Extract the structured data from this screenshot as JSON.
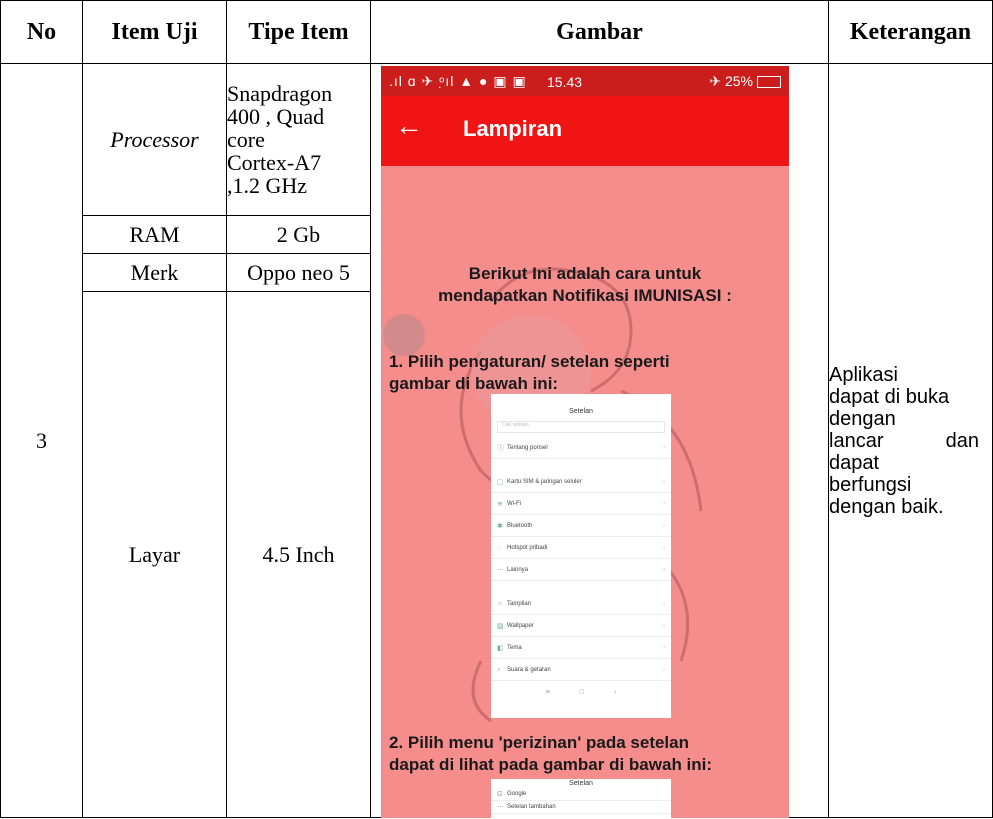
{
  "headers": {
    "no": "No",
    "item_uji": "Item Uji",
    "tipe_item": "Tipe Item",
    "gambar": "Gambar",
    "keterangan": "Keterangan"
  },
  "row": {
    "no": "3",
    "items": [
      {
        "item": "Processor",
        "tipe": [
          "Snapdragon",
          "400 , Quad",
          "core",
          "Cortex-A7",
          ",1.2 GHz"
        ]
      },
      {
        "item": "RAM",
        "tipe": "2 Gb"
      },
      {
        "item": "Merk",
        "tipe": "Oppo neo 5"
      },
      {
        "item": "Layar",
        "tipe": "4.5 Inch"
      }
    ],
    "keterangan": {
      "l1": "Aplikasi",
      "l2": "dapat di buka",
      "l3": "dengan",
      "l4a": "lancar",
      "l4b": "dan",
      "l5": "dapat",
      "l6": "berfungsi",
      "l7": "dengan baik."
    }
  },
  "phone": {
    "status_left": ".ıl ɑ ✈ ᵒ̣ıl ▲ ● ▣ ▣",
    "status_time": "15.43",
    "status_battery": "25%",
    "appbar_back": "←",
    "appbar_title": "Lampiran",
    "intro_line1": "Berikut Ini adalah cara untuk",
    "intro_line2": "mendapatkan Notifikasi IMUNISASI :",
    "step1_line1": "1. Pilih pengaturan/ setelan seperti",
    "step1_line2": "gambar di bawah ini:",
    "step2_line1": "2. Pilih menu 'perizinan' pada setelan",
    "step2_line2": "dapat di lihat pada gambar di bawah ini:",
    "shot1": {
      "title": "Setelan",
      "search": "Cari setelan",
      "rows": [
        {
          "icon": "ⓘ",
          "label": "Tentang ponsel",
          "value": ""
        },
        {
          "icon": "▢",
          "label": "Kartu SIM & jaringan seluler",
          "value": ""
        },
        {
          "icon": "≋",
          "label": "Wi-Fi",
          "value": ""
        },
        {
          "icon": "✱",
          "label": "Bluetooth",
          "value": ""
        },
        {
          "icon": "◌",
          "label": "Hotspot pribadi",
          "value": ""
        },
        {
          "icon": "⋯",
          "label": "Lainnya",
          "value": ""
        },
        {
          "icon": "☼",
          "label": "Tampilan",
          "value": ""
        },
        {
          "icon": "▨",
          "label": "Wallpaper",
          "value": ""
        },
        {
          "icon": "◧",
          "label": "Tema",
          "value": ""
        },
        {
          "icon": "♪",
          "label": "Suara & getaran",
          "value": ""
        }
      ],
      "nav": [
        "≡",
        "□",
        "‹"
      ]
    },
    "shot2": {
      "title": "Setelan",
      "rows": [
        {
          "icon": "G",
          "label": "Google"
        },
        {
          "icon": "⋯",
          "label": "Setelan tambahan"
        }
      ]
    },
    "colors": {
      "status_bar": "#cc1d1d",
      "app_bar": "#f01414",
      "background": "#f58d8d"
    }
  }
}
